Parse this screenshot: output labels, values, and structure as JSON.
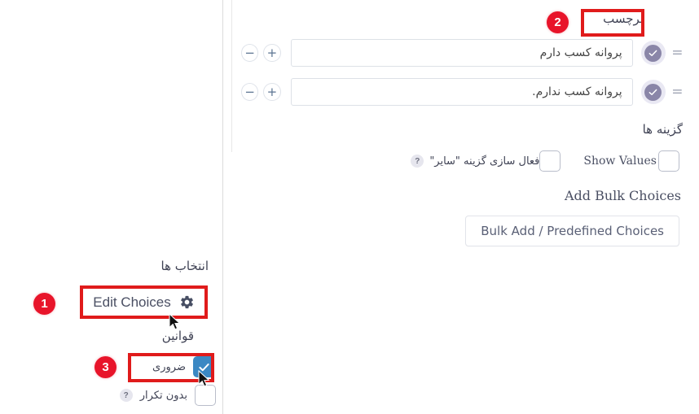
{
  "main": {
    "label_title": "برچسب",
    "choices": [
      {
        "value": "پروانه کسب دارم",
        "add_label": "+",
        "remove_label": "−",
        "handle": "="
      },
      {
        "value": "پروانه کسب ندارم.",
        "add_label": "+",
        "remove_label": "−",
        "handle": "="
      }
    ],
    "options_heading": "گزینه ها",
    "show_values_label": "Show Values",
    "enable_other_label": "فعال سازی گزینه \"سایر\"",
    "help_glyph": "?",
    "add_bulk_choices_heading": "Add Bulk Choices",
    "bulk_button_label": "Bulk Add / Predefined Choices"
  },
  "sidebar": {
    "choices_heading": "انتخاب ها",
    "edit_choices_label": "Edit Choices",
    "rules_heading": "قوانین",
    "rules": [
      {
        "label": "ضروری",
        "checked": true
      },
      {
        "label": "بدون تکرار",
        "checked": false,
        "help": "?"
      }
    ]
  },
  "annotations": {
    "badges": [
      {
        "number": "1"
      },
      {
        "number": "2"
      },
      {
        "number": "3"
      }
    ],
    "highlight_color": "#e01b1b",
    "badge_color": "#e8142a"
  }
}
